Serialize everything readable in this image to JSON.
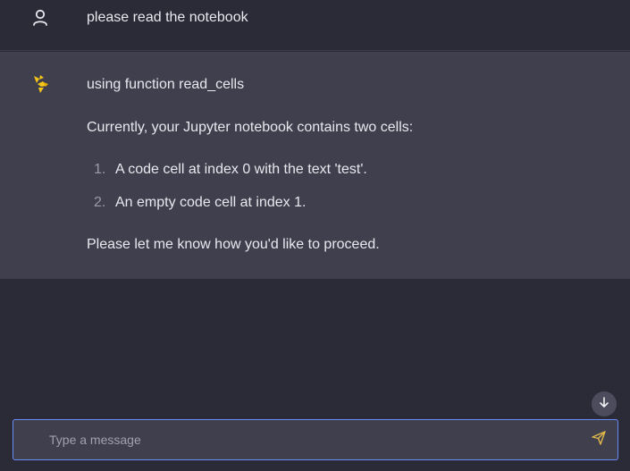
{
  "conversation": {
    "user_message": "please read the notebook",
    "assistant": {
      "function_call": "using function read_cells",
      "intro": "Currently, your Jupyter notebook contains two cells:",
      "list": [
        {
          "num": "1.",
          "text": "A code cell at index 0 with the text 'test'."
        },
        {
          "num": "2.",
          "text": "An empty code cell at index 1."
        }
      ],
      "outro": "Please let me know how you'd like to proceed."
    }
  },
  "composer": {
    "placeholder": "Type a message"
  },
  "icons": {
    "user": "user-icon",
    "assistant": "jupyter-bot-icon",
    "scroll": "arrow-down-icon",
    "send": "send-icon"
  },
  "colors": {
    "background": "#2b2b38",
    "assistant_bg": "#3f3f4e",
    "accent": "#6c8cf5",
    "bot_icon": "#f5c518",
    "send_icon": "#e0b84a"
  }
}
